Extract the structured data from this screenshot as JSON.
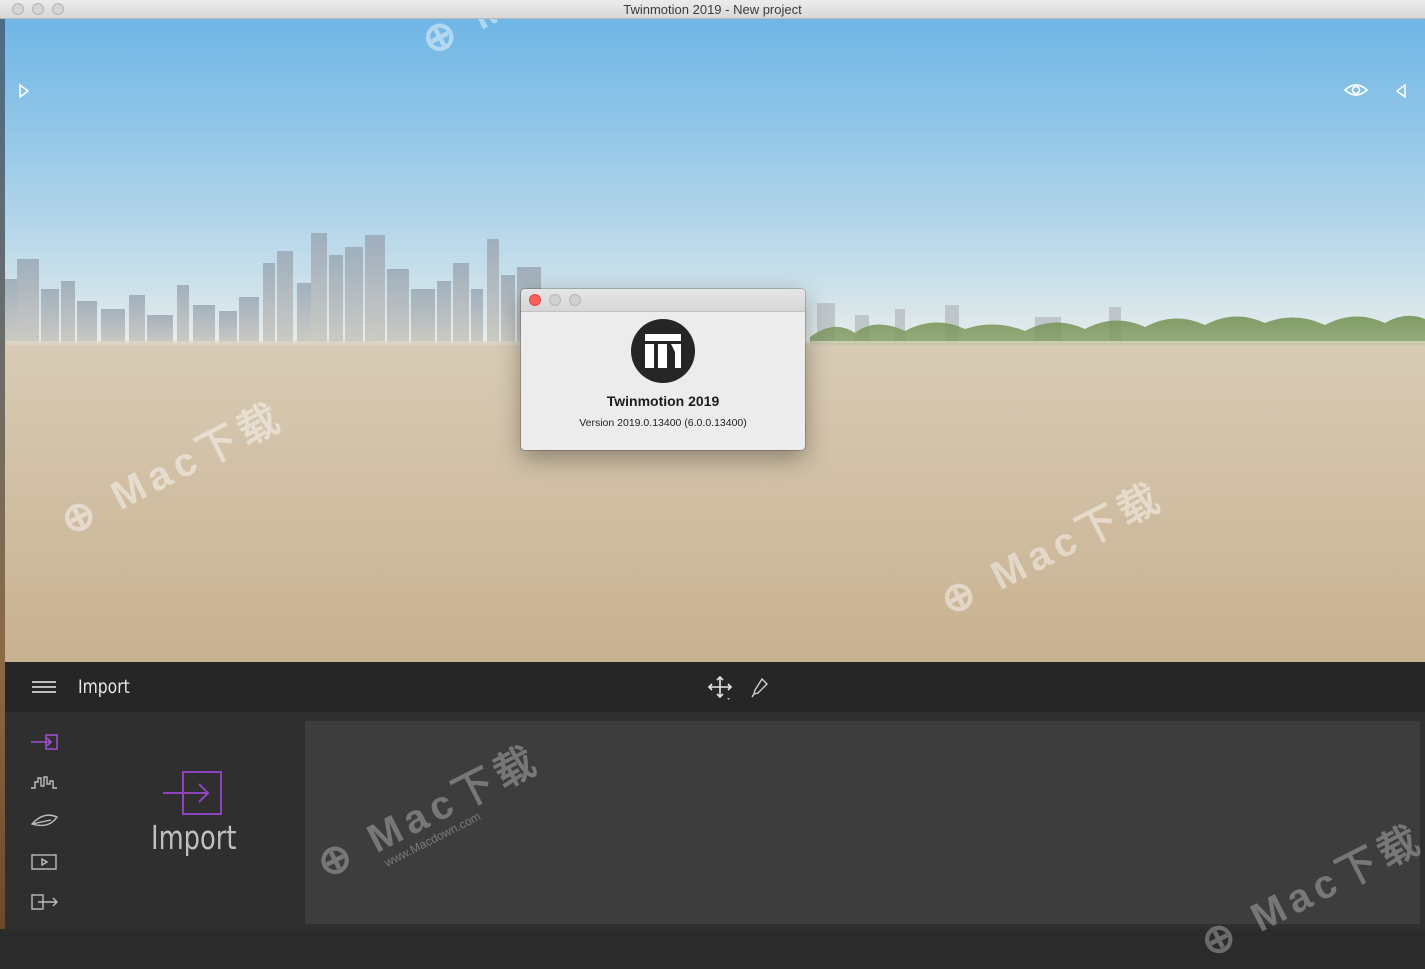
{
  "window": {
    "title": "Twinmotion 2019 - New project"
  },
  "about_dialog": {
    "app_name": "Twinmotion 2019",
    "version": "Version 2019.0.13400 (6.0.0.13400)"
  },
  "toolbar": {
    "section_title": "Import",
    "icons": [
      "menu-icon",
      "move-gizmo-icon",
      "color-picker-icon"
    ]
  },
  "side_nav": {
    "items": [
      {
        "icon": "import-icon",
        "active": true
      },
      {
        "icon": "context-icon",
        "active": false
      },
      {
        "icon": "landscape-icon",
        "active": false
      },
      {
        "icon": "media-icon",
        "active": false
      },
      {
        "icon": "export-icon",
        "active": false
      }
    ]
  },
  "import_panel": {
    "label": "Import"
  },
  "watermark": {
    "brand": "Mac下载",
    "url": "www.Macdown.com"
  },
  "colors": {
    "accent": "#9b4fc9",
    "toolbar_bg": "#262626",
    "panel_bg": "#2f2f2f",
    "content_bg": "#3d3d3d",
    "close_red": "#fc5f57"
  }
}
